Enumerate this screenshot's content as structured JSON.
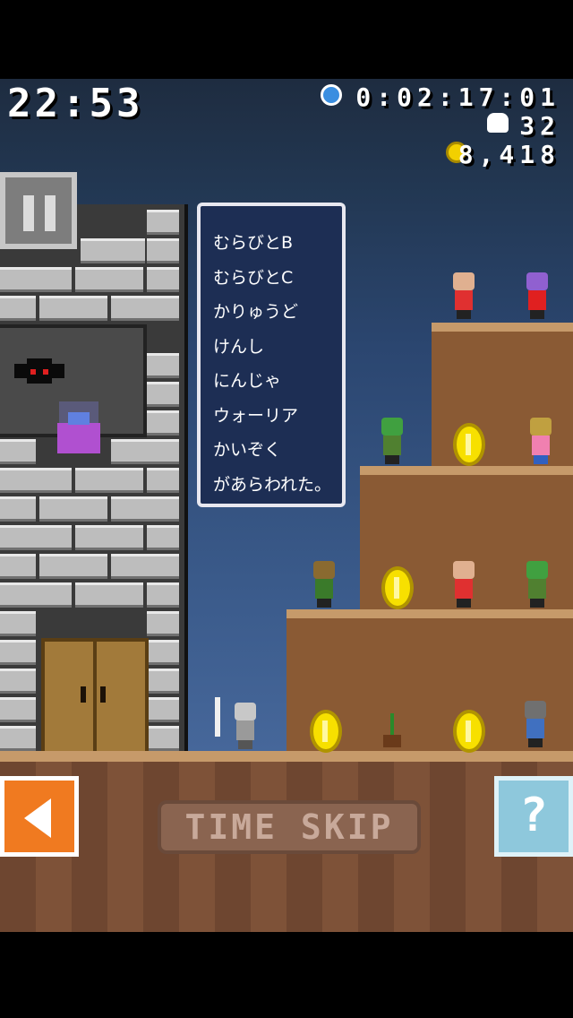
{
  "hud": {
    "clock": "22:53",
    "elapsed_time": "0:02:17:01",
    "kill_count": "32",
    "gold": "8,418",
    "icons": [
      "clock-icon",
      "skull-icon",
      "coin-icon"
    ]
  },
  "message_box": {
    "lines": [
      "むらびとB",
      "むらびとC",
      "かりゅうど",
      "けんし",
      "にんじゃ",
      "ウォーリア",
      "かいぞく",
      "があらわれた。"
    ]
  },
  "controls": {
    "time_skip_label": "TIME SKIP",
    "help_label": "?",
    "icons": [
      "pause-icon",
      "back-arrow-icon",
      "help-icon"
    ]
  },
  "colors": {
    "accent_orange": "#f07a20",
    "help_blue": "#8ec8dc",
    "message_bg": "#1d2e54",
    "coin_yellow": "#f7e000"
  }
}
